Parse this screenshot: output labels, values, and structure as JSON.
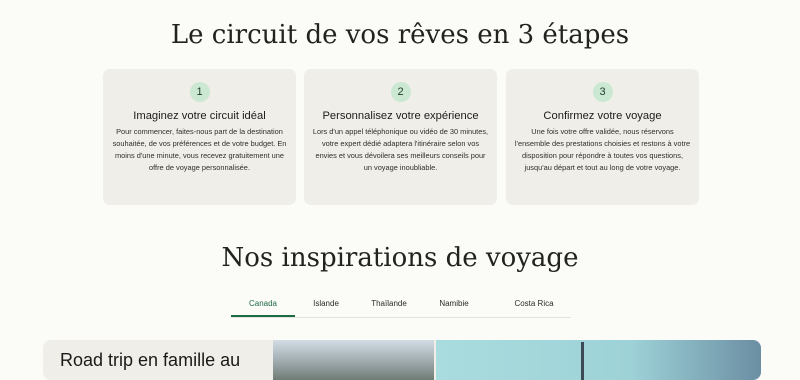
{
  "steps": {
    "title": "Le circuit de vos rêves en 3 étapes",
    "cards": [
      {
        "number": "1",
        "title": "Imaginez votre circuit idéal",
        "text": "Pour commencer, faites-nous part de la destination souhaitée, de vos préférences et de votre budget. En moins d'une minute, vous recevez gratuitement une offre de voyage personnalisée."
      },
      {
        "number": "2",
        "title": "Personnalisez votre expérience",
        "text": "Lors d'un appel téléphonique ou vidéo de 30 minutes, votre expert dédié adaptera l'itinéraire selon vos envies et vous dévoilera ses meilleurs conseils pour un voyage inoubliable."
      },
      {
        "number": "3",
        "title": "Confirmez votre voyage",
        "text": "Une fois votre offre validée, nous réservons l'ensemble des prestations choisies et restons à votre disposition pour répondre à toutes vos questions, jusqu'au départ et tout au long de votre voyage."
      }
    ]
  },
  "inspirations": {
    "title": "Nos inspirations de voyage",
    "tabs": [
      {
        "label": "Canada",
        "active": true
      },
      {
        "label": "Islande",
        "active": false
      },
      {
        "label": "Thaïlande",
        "active": false
      },
      {
        "label": "Namibie",
        "active": false
      },
      {
        "label": "Costa Rica",
        "active": false
      }
    ],
    "card": {
      "title": "Road trip en famille au"
    }
  },
  "colors": {
    "accent": "#1d6b45",
    "card_bg": "#efeee9",
    "number_badge": "#cbe8d3"
  }
}
